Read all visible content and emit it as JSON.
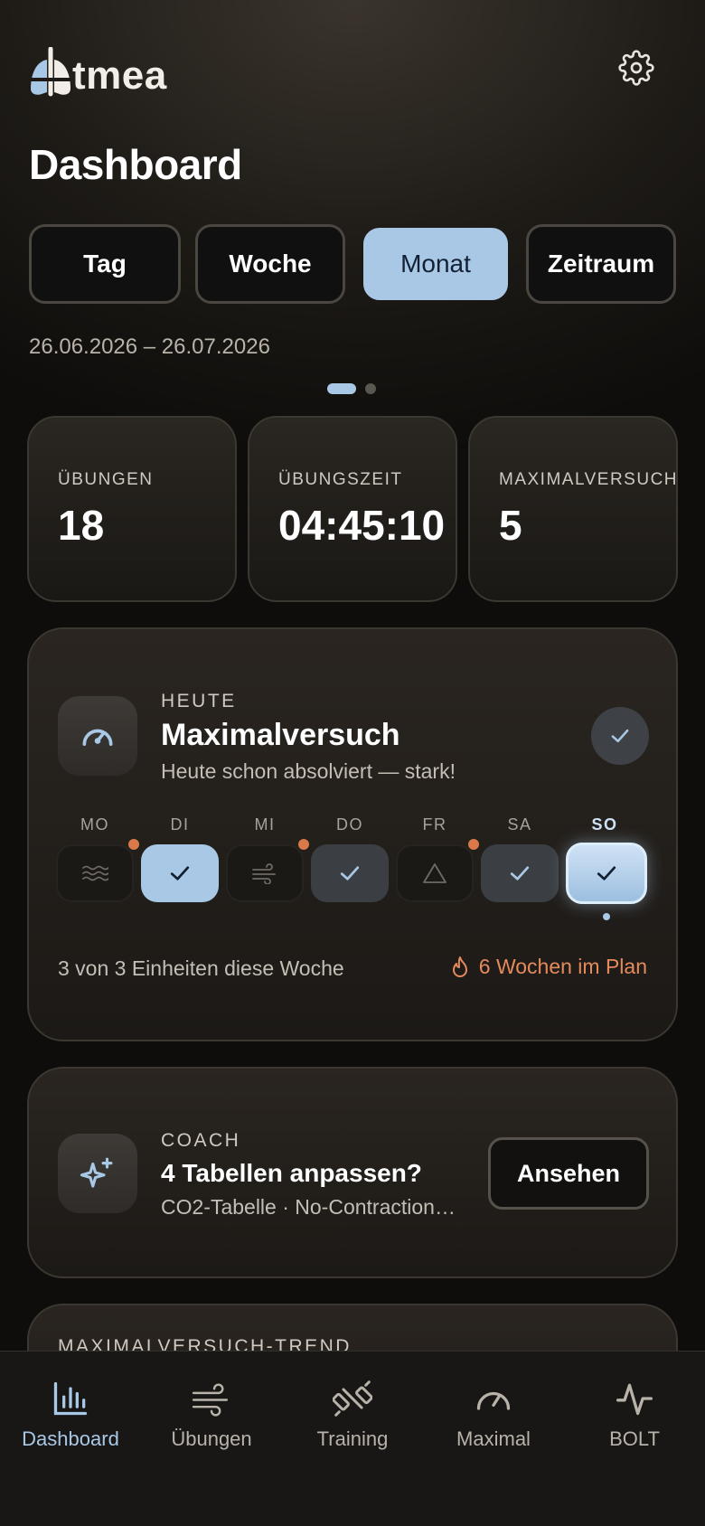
{
  "app": {
    "logo_text": "tmea",
    "logo_letter": "A"
  },
  "header": {
    "title": "Dashboard"
  },
  "periods": {
    "tabs": [
      {
        "label": "Tag",
        "active": false
      },
      {
        "label": "Woche",
        "active": false
      },
      {
        "label": "Monat",
        "active": true
      },
      {
        "label": "Zeitraum",
        "active": false
      }
    ],
    "range": "26.06.2026 – 26.07.2026"
  },
  "pager": {
    "count": 2,
    "active": 0
  },
  "stats": [
    {
      "label": "ÜBUNGEN",
      "value": "18"
    },
    {
      "label": "ÜBUNGSZEIT",
      "value": "04:45:10"
    },
    {
      "label": "MAXIMALVERSUCH",
      "value": "5"
    }
  ],
  "today": {
    "eyebrow": "HEUTE",
    "title": "Maximalversuch",
    "subtitle": "Heute schon absolviert — stark!",
    "icon": "gauge-icon",
    "done_icon": "check-icon",
    "days": [
      {
        "label": "MO",
        "state": "empty",
        "icon": "waves-icon",
        "badge": true
      },
      {
        "label": "DI",
        "state": "light",
        "icon": "check-icon",
        "badge": false
      },
      {
        "label": "MI",
        "state": "empty",
        "icon": "wind-icon",
        "badge": true
      },
      {
        "label": "DO",
        "state": "dark",
        "icon": "check-icon",
        "badge": false
      },
      {
        "label": "FR",
        "state": "empty",
        "icon": "triangle-icon",
        "badge": true
      },
      {
        "label": "SA",
        "state": "dark",
        "icon": "check-icon",
        "badge": false
      },
      {
        "label": "SO",
        "state": "today",
        "icon": "check-icon",
        "badge": false
      }
    ],
    "summary": "3 von 3 Einheiten diese Woche",
    "streak": "6 Wochen im Plan"
  },
  "coach": {
    "eyebrow": "COACH",
    "title": "4 Tabellen anpassen?",
    "subtitle": "CO2-Tabelle · No-Contraction…",
    "button": "Ansehen",
    "icon": "sparkle-icon"
  },
  "trend": {
    "label": "MAXIMALVERSUCH-TREND"
  },
  "nav": [
    {
      "label": "Dashboard",
      "icon": "bar-chart-icon",
      "active": true
    },
    {
      "label": "Übungen",
      "icon": "wind-icon",
      "active": false
    },
    {
      "label": "Training",
      "icon": "dumbbell-icon",
      "active": false
    },
    {
      "label": "Maximal",
      "icon": "gauge-icon",
      "active": false
    },
    {
      "label": "BOLT",
      "icon": "pulse-icon",
      "active": false
    }
  ],
  "colors": {
    "accent": "#a9c8e6",
    "streak": "#e58a5a",
    "badge": "#d97a4a"
  }
}
